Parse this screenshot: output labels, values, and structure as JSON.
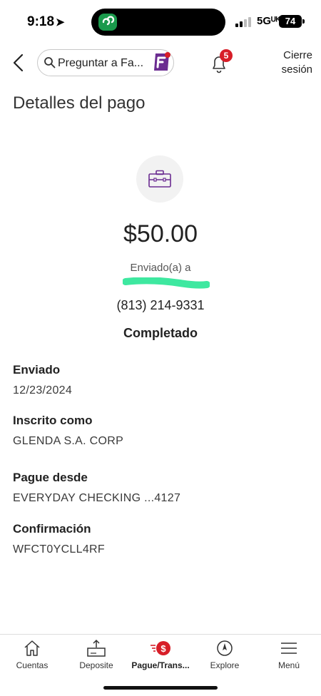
{
  "status_bar": {
    "time": "9:18",
    "location_glyph": "➤",
    "network": "5Gᵁᴷ",
    "battery": "74"
  },
  "header": {
    "search_placeholder": "Preguntar a Fa...",
    "notification_count": "5",
    "logout_line1": "Cierre",
    "logout_line2": "sesión"
  },
  "page": {
    "title": "Detalles del pago"
  },
  "payment": {
    "amount": "$50.00",
    "sent_to_label": "Enviado(a) a",
    "phone": "(813) 214-9331",
    "status": "Completado"
  },
  "details": [
    {
      "label": "Enviado",
      "value": "12/23/2024"
    },
    {
      "label": "Inscrito como",
      "value": "GLENDA S.A. CORP"
    },
    {
      "label": "Pague desde",
      "value": "EVERYDAY CHECKING ...4127"
    },
    {
      "label": "Confirmación",
      "value": "WFCT0YCLL4RF"
    }
  ],
  "bottom_nav": [
    {
      "label": "Cuentas",
      "icon": "home-icon"
    },
    {
      "label": "Deposite",
      "icon": "deposit-icon"
    },
    {
      "label": "Pague/Trans...",
      "icon": "pay-transfer-icon",
      "active": true
    },
    {
      "label": "Explore",
      "icon": "compass-icon"
    },
    {
      "label": "Menú",
      "icon": "menu-icon"
    }
  ],
  "colors": {
    "brand_red": "#d71e28",
    "brand_purple": "#6b2c91",
    "redaction": "#3ee8a0"
  }
}
